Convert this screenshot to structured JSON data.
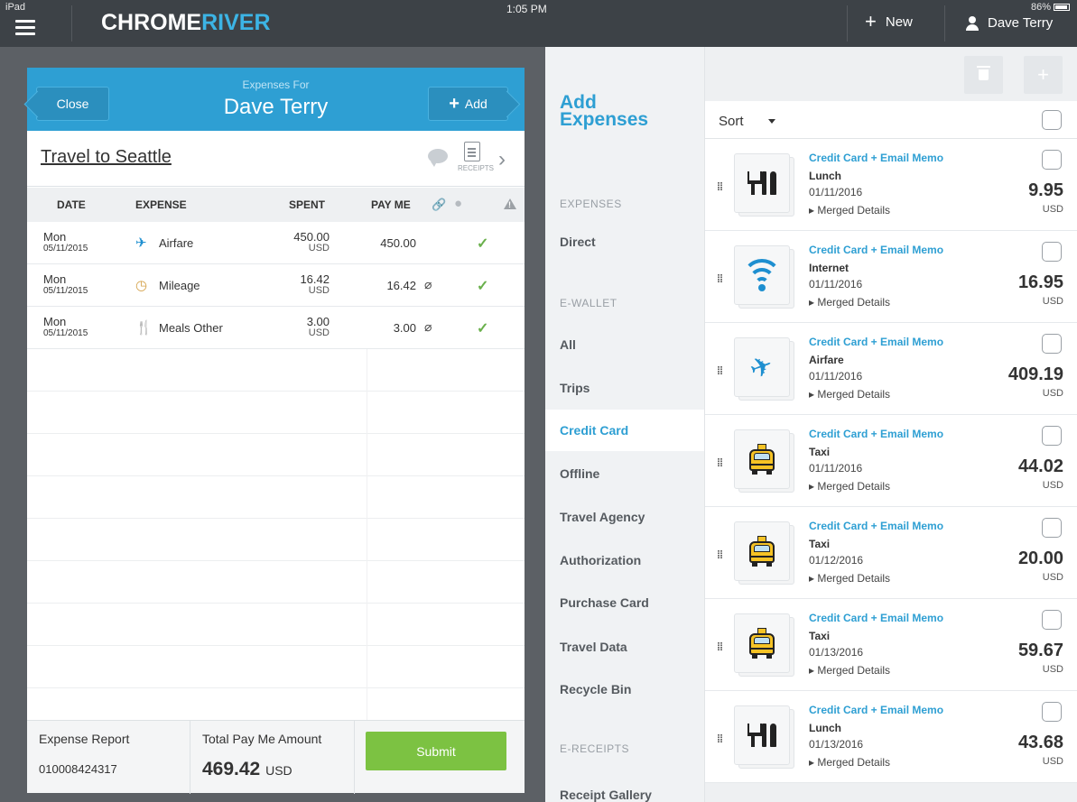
{
  "status": {
    "carrier": "iPad",
    "time": "1:05 PM",
    "battery": "86%"
  },
  "topbar": {
    "brand_part1": "CHROME",
    "brand_part2": "RIVER",
    "new_label": "New",
    "user_name": "Dave Terry"
  },
  "report": {
    "close_label": "Close",
    "expenses_for_label": "Expenses For",
    "person_name": "Dave Terry",
    "add_label": "Add",
    "title": "Travel to Seattle",
    "receipts_label": "RECEIPTS",
    "columns": {
      "date": "DATE",
      "expense": "EXPENSE",
      "spent": "SPENT",
      "pay_me": "PAY ME"
    },
    "rows": [
      {
        "day": "Mon",
        "date": "05/11/2015",
        "icon": "airfare-icon",
        "glyph": "✈",
        "expense": "Airfare",
        "spent": "450.00",
        "currency": "USD",
        "pay_me": "450.00",
        "has_attachment": false,
        "status": "approved"
      },
      {
        "day": "Mon",
        "date": "05/11/2015",
        "icon": "mileage-icon",
        "glyph": "◷",
        "expense": "Mileage",
        "spent": "16.42",
        "currency": "USD",
        "pay_me": "16.42",
        "has_attachment": true,
        "status": "approved"
      },
      {
        "day": "Mon",
        "date": "05/11/2015",
        "icon": "meals-icon",
        "glyph": "🍴",
        "expense": "Meals Other",
        "spent": "3.00",
        "currency": "USD",
        "pay_me": "3.00",
        "has_attachment": true,
        "status": "approved"
      }
    ],
    "footer": {
      "report_label": "Expense Report",
      "report_number": "010008424317",
      "total_label": "Total Pay Me Amount",
      "total_amount": "469.42",
      "total_currency": "USD",
      "submit_label": "Submit"
    }
  },
  "nav": {
    "title_line1": "Add",
    "title_line2": "Expenses",
    "section_expenses": "EXPENSES",
    "direct": "Direct",
    "section_ewallet": "E-WALLET",
    "all": "All",
    "trips": "Trips",
    "credit_card": "Credit Card",
    "offline": "Offline",
    "travel_agency": "Travel Agency",
    "authorization": "Authorization",
    "purchase_card": "Purchase Card",
    "travel_data": "Travel Data",
    "recycle_bin": "Recycle Bin",
    "section_ereceipts": "E-RECEIPTS",
    "receipt_gallery": "Receipt Gallery",
    "active": "Credit Card"
  },
  "list": {
    "sort_label": "Sort",
    "items": [
      {
        "source": "Credit Card + Email Memo",
        "type": "Lunch",
        "icon": "fork-knife-icon",
        "date": "01/11/2016",
        "details": "Merged Details",
        "amount": "9.95",
        "currency": "USD"
      },
      {
        "source": "Credit Card + Email Memo",
        "type": "Internet",
        "icon": "wifi-icon",
        "date": "01/11/2016",
        "details": "Merged Details",
        "amount": "16.95",
        "currency": "USD"
      },
      {
        "source": "Credit Card + Email Memo",
        "type": "Airfare",
        "icon": "airplane-icon",
        "date": "01/11/2016",
        "details": "Merged Details",
        "amount": "409.19",
        "currency": "USD"
      },
      {
        "source": "Credit Card + Email Memo",
        "type": "Taxi",
        "icon": "taxi-icon",
        "date": "01/11/2016",
        "details": "Merged Details",
        "amount": "44.02",
        "currency": "USD"
      },
      {
        "source": "Credit Card + Email Memo",
        "type": "Taxi",
        "icon": "taxi-icon",
        "date": "01/12/2016",
        "details": "Merged Details",
        "amount": "20.00",
        "currency": "USD"
      },
      {
        "source": "Credit Card + Email Memo",
        "type": "Taxi",
        "icon": "taxi-icon",
        "date": "01/13/2016",
        "details": "Merged Details",
        "amount": "59.67",
        "currency": "USD"
      },
      {
        "source": "Credit Card + Email Memo",
        "type": "Lunch",
        "icon": "fork-knife-icon",
        "date": "01/13/2016",
        "details": "Merged Details",
        "amount": "43.68",
        "currency": "USD"
      }
    ]
  },
  "colors": {
    "accent": "#2e9fd3",
    "submit": "#7cc242",
    "topbar": "#3d4247",
    "check": "#6ab04c"
  }
}
